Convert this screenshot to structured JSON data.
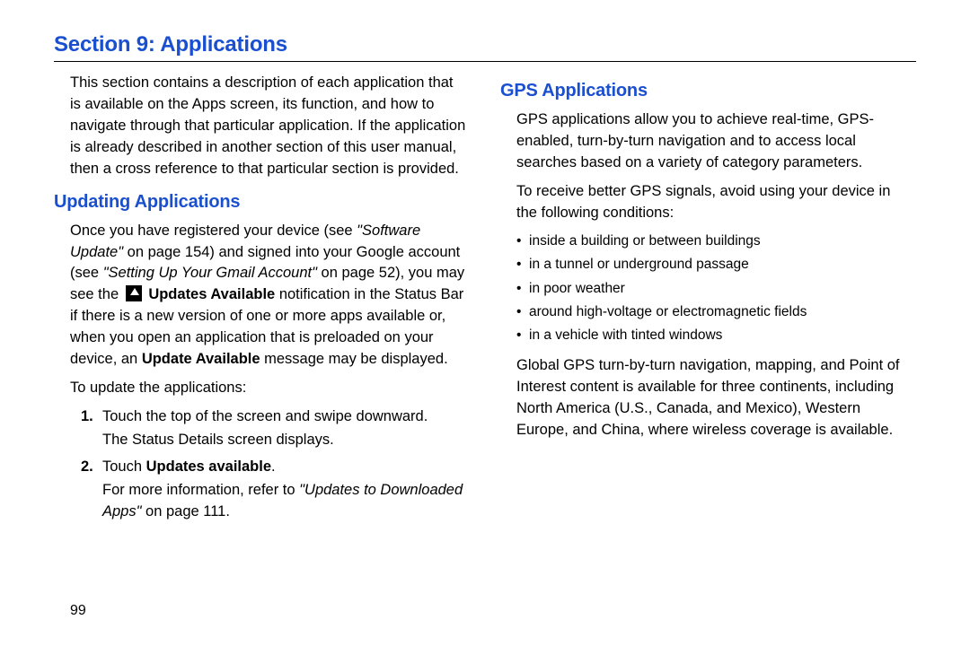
{
  "section_title": "Section 9: Applications",
  "intro": "This section contains a description of each application that is available on the Apps screen, its function, and how to navigate through that particular application. If the application is already described in another section of this user manual, then a cross reference to that particular section is provided.",
  "updating": {
    "heading": "Updating Applications",
    "p1_a": "Once you have registered your device (see ",
    "p1_ref1": "\"Software Update\"",
    "p1_b": " on page 154) and signed into your Google account (see ",
    "p1_ref2": "\"Setting Up Your Gmail Account\"",
    "p1_c": " on page 52), you may see the ",
    "p1_bold1": "Updates Available",
    "p1_d": " notification in the Status Bar if there is a new version of one or more apps available or, when you open an application that is preloaded on your device, an ",
    "p1_bold2": "Update Available",
    "p1_e": " message may be displayed.",
    "p2": "To update the applications:",
    "step1_a": "Touch the top of the screen and swipe downward.",
    "step1_b": "The Status Details screen displays.",
    "step2_a": "Touch ",
    "step2_bold": "Updates available",
    "step2_b": ".",
    "step2_sub_a": "For more information, refer to ",
    "step2_sub_ref": "\"Updates to Downloaded Apps\"",
    "step2_sub_b": " on page 111."
  },
  "gps": {
    "heading": "GPS Applications",
    "p1": "GPS applications allow you to achieve real-time, GPS-enabled, turn-by-turn navigation and to access local searches based on a variety of category parameters.",
    "p2": "To receive better GPS signals, avoid using your device in the following conditions:",
    "bullets": [
      "inside a building or between buildings",
      "in a tunnel or underground passage",
      "in poor weather",
      "around high-voltage or electromagnetic fields",
      "in a vehicle with tinted windows"
    ],
    "p3": "Global GPS turn-by-turn navigation, mapping, and Point of Interest content is available for three continents, including North America (U.S., Canada, and Mexico), Western Europe, and China, where wireless coverage is available."
  },
  "page_number": "99"
}
